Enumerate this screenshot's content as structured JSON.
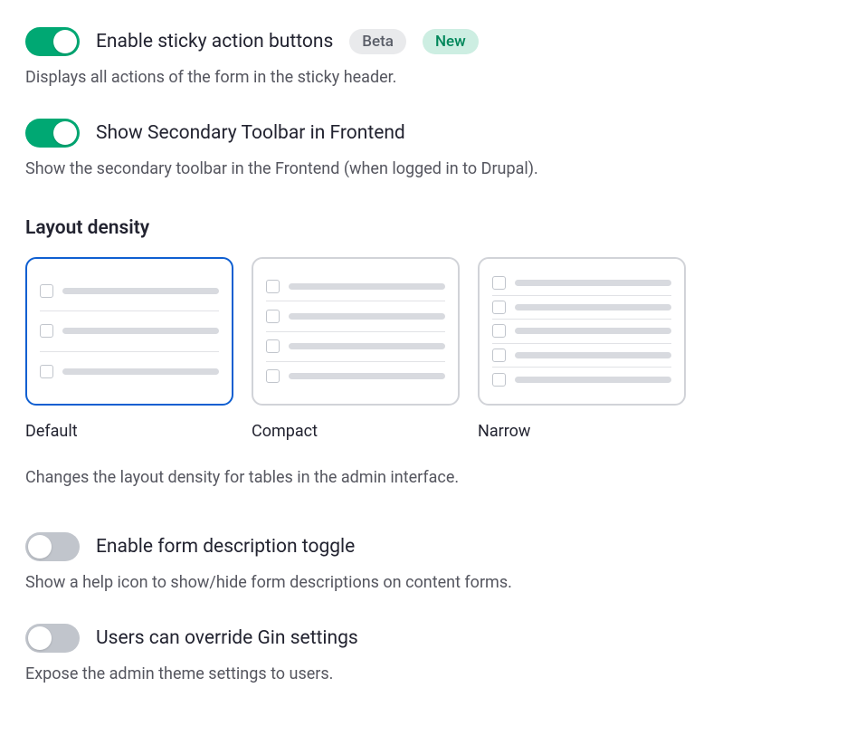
{
  "settings": {
    "sticky_buttons": {
      "label": "Enable sticky action buttons",
      "badge_beta": "Beta",
      "badge_new": "New",
      "desc": "Displays all actions of the form in the sticky header."
    },
    "secondary_toolbar": {
      "label": "Show Secondary Toolbar in Frontend",
      "desc": "Show the secondary toolbar in the Frontend (when logged in to Drupal)."
    },
    "layout_density": {
      "title": "Layout density",
      "options": [
        {
          "label": "Default"
        },
        {
          "label": "Compact"
        },
        {
          "label": "Narrow"
        }
      ],
      "desc": "Changes the layout density for tables in the admin interface."
    },
    "form_desc_toggle": {
      "label": "Enable form description toggle",
      "desc": "Show a help icon to show/hide form descriptions on content forms."
    },
    "user_override": {
      "label": "Users can override Gin settings",
      "desc": "Expose the admin theme settings to users."
    }
  }
}
